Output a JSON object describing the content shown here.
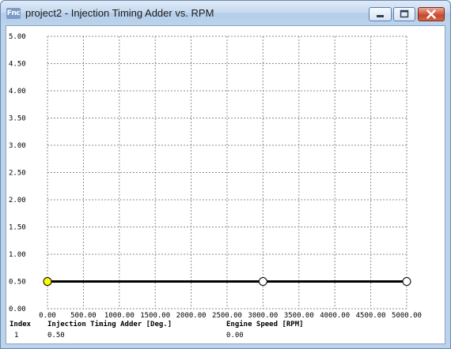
{
  "window": {
    "icon_text": "Fnc",
    "title": "project2 - Injection Timing Adder vs. RPM",
    "controls": [
      "minimize",
      "maximize",
      "close"
    ]
  },
  "info_table": {
    "headers": [
      "Index",
      "Injection Timing Adder [Deg.]",
      "Engine Speed [RPM]"
    ],
    "row": [
      "1",
      "0.50",
      "0.00"
    ]
  },
  "chart_data": {
    "type": "line",
    "title": "",
    "xlabel": "",
    "ylabel": "",
    "x_ticks": [
      "0.00",
      "500.00",
      "1000.00",
      "1500.00",
      "2000.00",
      "2500.00",
      "3000.00",
      "3500.00",
      "4000.00",
      "4500.00",
      "5000.00"
    ],
    "y_ticks": [
      "0.00",
      "0.50",
      "1.00",
      "1.50",
      "2.00",
      "2.50",
      "3.00",
      "3.50",
      "4.00",
      "4.50",
      "5.00"
    ],
    "xlim": [
      0,
      5000
    ],
    "ylim": [
      0,
      5
    ],
    "grid": true,
    "series": [
      {
        "x": [
          0,
          3000,
          5000
        ],
        "y": [
          0.5,
          0.5,
          0.5
        ],
        "point_fill": [
          "#ffff00",
          "#ffffff",
          "#ffffff"
        ],
        "color": "#000000"
      }
    ]
  }
}
